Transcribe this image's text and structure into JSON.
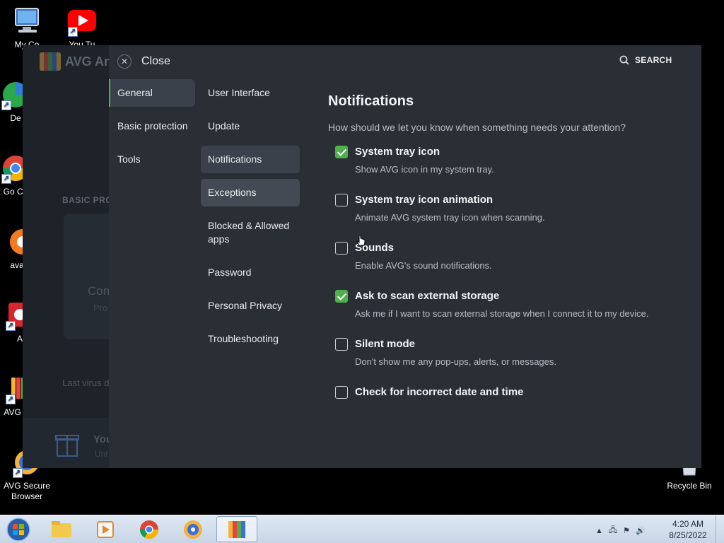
{
  "desktop": {
    "icons": [
      {
        "label": "My Co"
      },
      {
        "label": "You Tu"
      },
      {
        "label": "De"
      },
      {
        "label": "Go Ch"
      },
      {
        "label": "avast_"
      },
      {
        "label": "A"
      },
      {
        "label": "AVG A F"
      },
      {
        "label": "AVG Secure Browser"
      },
      {
        "label": "Recycle Bin"
      }
    ]
  },
  "background_window": {
    "title": "AVG An",
    "basic_label": "BASIC PRO",
    "card_text1": "Con",
    "card_text2": "Pro",
    "last_virus": "Last virus d",
    "bottom_title": "You",
    "bottom_sub": "Unl"
  },
  "settings": {
    "close_label": "Close",
    "search_label": "SEARCH",
    "nav_primary": [
      {
        "label": "General",
        "active": true
      },
      {
        "label": "Basic protection",
        "active": false
      },
      {
        "label": "Tools",
        "active": false
      }
    ],
    "nav_secondary": [
      {
        "label": "User Interface"
      },
      {
        "label": "Update"
      },
      {
        "label": "Notifications",
        "state": "active"
      },
      {
        "label": "Exceptions",
        "state": "hover"
      },
      {
        "label": "Blocked & Allowed apps"
      },
      {
        "label": "Password"
      },
      {
        "label": "Personal Privacy"
      },
      {
        "label": "Troubleshooting"
      }
    ],
    "content": {
      "title": "Notifications",
      "subtitle": "How should we let you know when something needs your attention?",
      "options": [
        {
          "label": "System tray icon",
          "desc": "Show AVG icon in my system tray.",
          "checked": true
        },
        {
          "label": "System tray icon animation",
          "desc": "Animate AVG system tray icon when scanning.",
          "checked": false
        },
        {
          "label": "Sounds",
          "desc": "Enable AVG's sound notifications.",
          "checked": false
        },
        {
          "label": "Ask to scan external storage",
          "desc": "Ask me if I want to scan external storage when I connect it to my device.",
          "checked": true
        },
        {
          "label": "Silent mode",
          "desc": "Don't show me any pop-ups, alerts, or messages.",
          "checked": false
        },
        {
          "label": "Check for incorrect date and time",
          "desc": "",
          "checked": false
        }
      ]
    }
  },
  "taskbar": {
    "time": "4:20 AM",
    "date": "8/25/2022"
  },
  "colors": {
    "accent_green": "#4fb14a",
    "panel_bg": "#2a2f36",
    "selected_bg": "#3a414a"
  }
}
